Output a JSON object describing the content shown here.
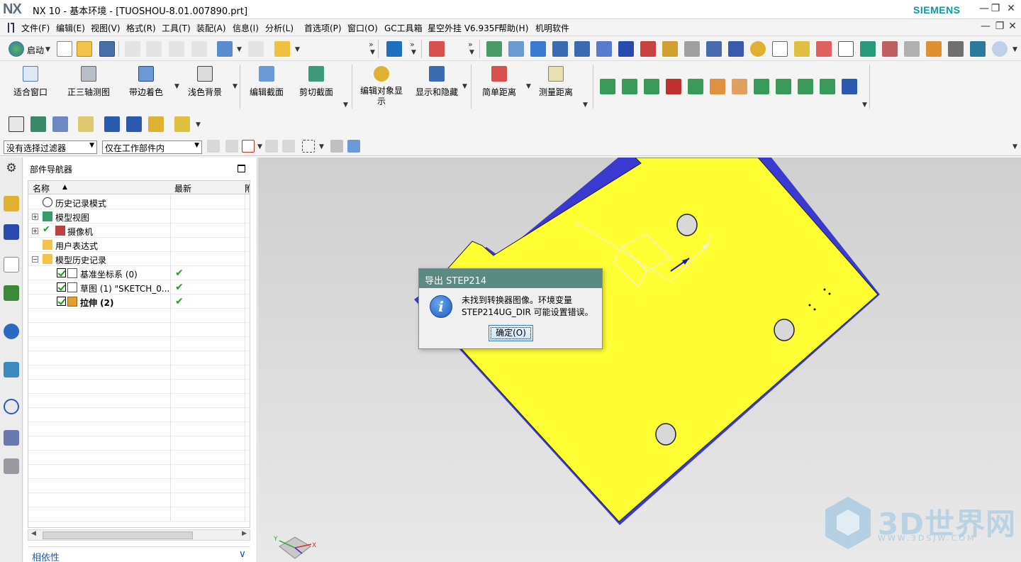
{
  "window": {
    "logo": "NX",
    "title": "NX 10 - 基本环境 - [TUOSHOU-8.01.007890.prt]",
    "brand": "SIEMENS",
    "min": "—",
    "restore": "❐",
    "close": "✕"
  },
  "menu": {
    "items": [
      "文件(F)",
      "编辑(E)",
      "视图(V)",
      "格式(R)",
      "工具(T)",
      "装配(A)",
      "信息(I)",
      "分析(L)",
      "首选项(P)",
      "窗口(O)",
      "GC工具箱",
      "星空外挂 V6.935F",
      "帮助(H)",
      "机明软件"
    ]
  },
  "toolbar": {
    "start_label": "启动"
  },
  "ribbon": {
    "buttons": [
      "适合窗口",
      "正三轴测图",
      "带边着色",
      "浅色背景",
      "编辑截面",
      "剪切截面",
      "编辑对象显示",
      "显示和隐藏",
      "简单距离",
      "测量距离"
    ]
  },
  "filters": {
    "selection_filter": "没有选择过滤器",
    "scope_filter": "仅在工作部件内"
  },
  "navigator": {
    "title": "部件导航器",
    "columns": [
      "名称",
      "最新",
      "附"
    ],
    "rows": [
      {
        "label": "历史记录模式",
        "latest": ""
      },
      {
        "label": "模型视图",
        "latest": ""
      },
      {
        "label": "摄像机",
        "latest": ""
      },
      {
        "label": "用户表达式",
        "latest": ""
      },
      {
        "label": "模型历史记录",
        "latest": ""
      },
      {
        "label": "基准坐标系 (0)",
        "latest": "✔"
      },
      {
        "label": "草图 (1) \"SKETCH_0...",
        "latest": "✔"
      },
      {
        "label": "拉伸 (2)",
        "latest": "✔"
      }
    ],
    "dependency_label": "相依性"
  },
  "dialog": {
    "title": "导出 STEP214",
    "message_line1": "未找到转换器图像。环境变量",
    "message_line2": "STEP214UG_DIR 可能设置错误。",
    "ok_label": "确定(O)"
  },
  "viewport": {
    "part_color": "#ffff33",
    "triad_label_x": "X",
    "triad_label_y": "Y"
  },
  "watermark": {
    "text": "3D世界网",
    "sub": "WWW.3DSJW.COM"
  }
}
